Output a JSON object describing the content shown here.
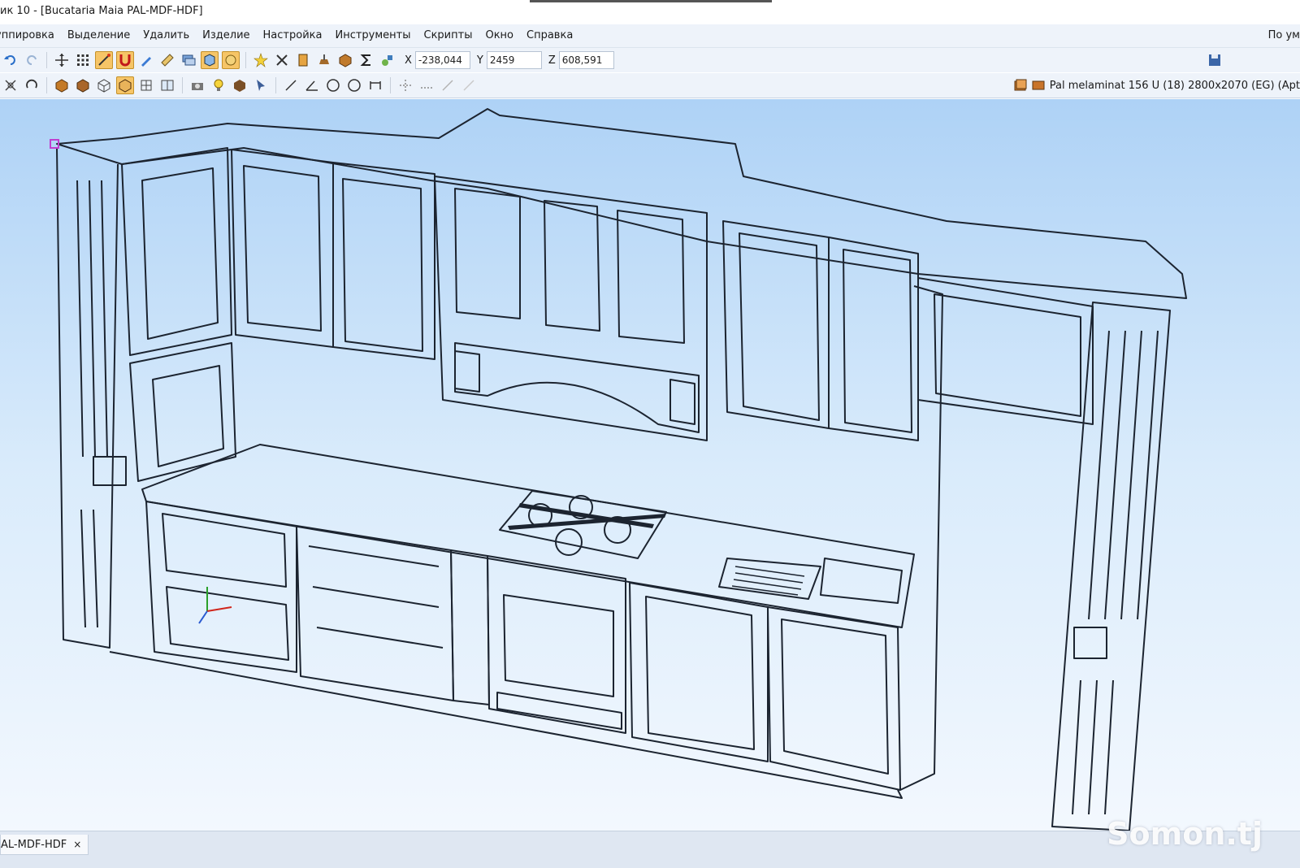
{
  "window": {
    "title": "ик 10 - [Bucataria Maia PAL-MDF-HDF]"
  },
  "menu": {
    "items": [
      "уппировка",
      "Выделение",
      "Удалить",
      "Изделие",
      "Настройка",
      "Инструменты",
      "Скрипты",
      "Окно",
      "Справка"
    ],
    "right_label": "По ум"
  },
  "coords": {
    "x_label": "X",
    "x_value": "-238,044",
    "y_label": "Y",
    "y_value": "2459",
    "z_label": "Z",
    "z_value": "608,591"
  },
  "material": {
    "label": "Pal melaminat 156 U (18) 2800x2070 (EG) (Apt"
  },
  "tabs": {
    "doc_tab": "AL-MDF-HDF",
    "close_glyph": "×"
  },
  "watermark": "Somon.tj",
  "colors": {
    "viewport_top": "#aed2f6",
    "viewport_bottom": "#f3f8fe",
    "menubar": "#eef3fa",
    "active_tool": "#f6c567",
    "line": "#1c2430"
  },
  "icons": {
    "toolbar1": [
      "undo-icon",
      "redo-icon",
      "move-icon",
      "grid-icon",
      "snap-icon",
      "magnet-icon",
      "pencil-icon",
      "ruler-icon",
      "layers-icon",
      "view3d-icon",
      "view-active-icon",
      "light-icon",
      "cut-icon",
      "book-icon",
      "paint-icon",
      "box-icon",
      "sum-icon",
      "tools-icon",
      "save-icon"
    ],
    "toolbar2": [
      "rotate-icon",
      "orbit-icon",
      "solid-icon",
      "shaded-icon",
      "wire-icon",
      "hidden-icon",
      "wire-active-icon",
      "split-icon",
      "camera-icon",
      "bulb-icon",
      "material-icon",
      "select-icon",
      "line-icon",
      "angle-icon",
      "circle-icon",
      "circle2-icon",
      "dim-icon",
      "trim-icon",
      "offset-icon",
      "mirror-icon",
      "array-icon"
    ]
  }
}
